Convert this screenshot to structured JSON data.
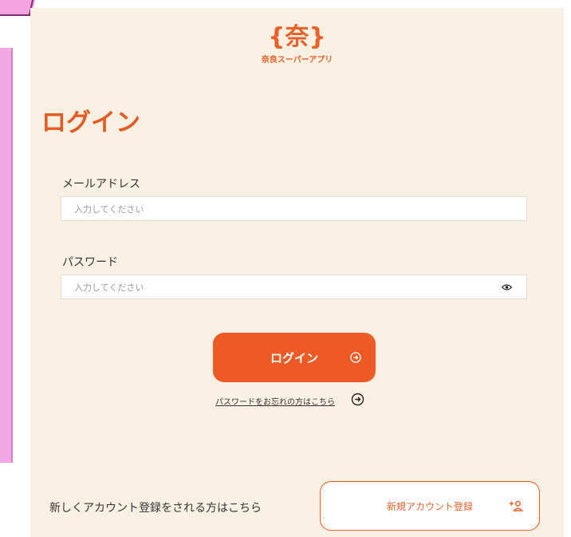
{
  "logo": {
    "mark": "{奈}",
    "name": "奈良スーパーアプリ"
  },
  "page_title": "ログイン",
  "email": {
    "label": "メールアドレス",
    "placeholder": "入力してください"
  },
  "password": {
    "label": "パスワード",
    "placeholder": "入力してください",
    "toggle_icon": "eye-icon"
  },
  "login_button": {
    "label": "ログイン",
    "icon": "arrow-circle-icon"
  },
  "forgot_password": {
    "label": "パスワードをお忘れの方はこちら",
    "icon": "arrow-circle-icon"
  },
  "signup": {
    "prompt": "新しくアカウント登録をされる方はこちら",
    "button_label": "新規アカウント登録",
    "icon": "add-user-icon"
  },
  "colors": {
    "accent": "#EE5A25",
    "panel_bg": "#F8F0E3",
    "pink_overlay": "#F2A9E3"
  }
}
